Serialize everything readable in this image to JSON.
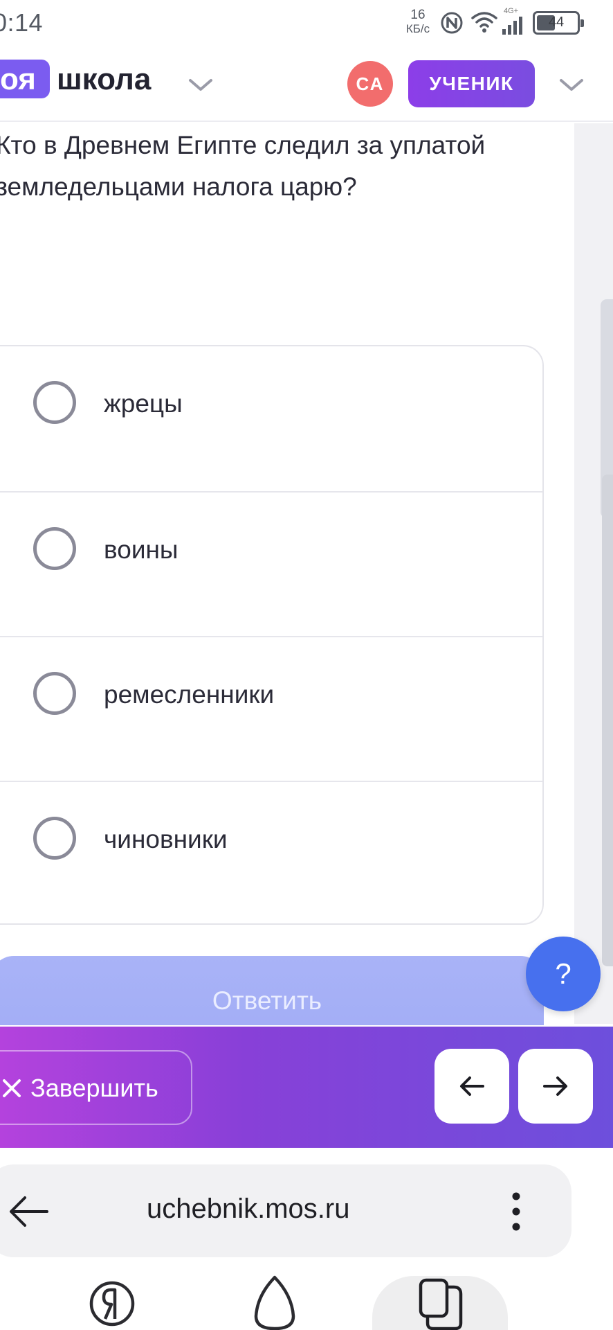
{
  "status_bar": {
    "time": "0:14",
    "net_speed_value": "16",
    "net_speed_unit": "КБ/с",
    "network_tag": "4G+",
    "battery": "44"
  },
  "header": {
    "logo_left": "оя",
    "logo_right": "школа",
    "avatar_initials": "СА",
    "role": "УЧЕНИК"
  },
  "question": {
    "text": "Кто в Древнем Египте следил за уплатой земледельцами налога царю?"
  },
  "options": [
    {
      "label": "жрецы",
      "selected": false
    },
    {
      "label": "воины",
      "selected": false
    },
    {
      "label": "ремесленники",
      "selected": false
    },
    {
      "label": "чиновники",
      "selected": false
    }
  ],
  "actions": {
    "answer_label": "Ответить",
    "help_label": "?",
    "finish_label": "Завершить"
  },
  "browser": {
    "url": "uchebnik.mos.ru"
  },
  "colors": {
    "brand_purple": "#7b5cf0",
    "role_badge": "#8c3ee8",
    "avatar": "#f26d6d",
    "answer_button_disabled": "#a9b3f7",
    "help_button": "#4770ee",
    "action_bar_start": "#b442dd",
    "action_bar_end": "#6d4fdc"
  },
  "icons": {
    "status": [
      "nfc-icon",
      "wifi-icon",
      "signal-icon",
      "battery-icon"
    ],
    "header": [
      "chevron-down-icon"
    ],
    "navigation": [
      "arrow-left-icon",
      "arrow-right-icon",
      "close-icon"
    ],
    "browser": [
      "back-arrow-icon",
      "more-vertical-icon",
      "yandex-icon",
      "alice-icon",
      "tabs-icon"
    ]
  }
}
